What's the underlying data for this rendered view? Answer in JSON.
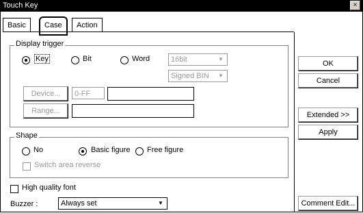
{
  "window": {
    "title": "Touch Key",
    "close_glyph": "×"
  },
  "tabs": [
    {
      "label": "Basic"
    },
    {
      "label": "Case"
    },
    {
      "label": "Action"
    }
  ],
  "display_trigger": {
    "group_label": "Display trigger",
    "options": [
      {
        "label": "Key",
        "selected": true
      },
      {
        "label": "Bit",
        "selected": false
      },
      {
        "label": "Word",
        "selected": false
      }
    ],
    "bit_select": {
      "value": "16bit",
      "arrow": "▼"
    },
    "format_select": {
      "value": "Signed BIN",
      "arrow": "▼"
    },
    "device_button": "Device...",
    "device_range_text": "0-FF",
    "range_button": "Range..."
  },
  "shape": {
    "group_label": "Shape",
    "options": [
      {
        "label": "No",
        "selected": false
      },
      {
        "label": "Basic figure",
        "selected": true
      },
      {
        "label": "Free figure",
        "selected": false
      }
    ],
    "switch_area_reverse": {
      "label": "Switch area reverse",
      "checked": false
    }
  },
  "high_quality_font": {
    "label": "High quality font",
    "checked": false
  },
  "buzzer": {
    "label": "Buzzer :",
    "value": "Always set",
    "arrow": "▼"
  },
  "side_buttons": {
    "ok": "OK",
    "cancel": "Cancel",
    "extended": "Extended >>",
    "apply": "Apply",
    "comment_edit": "Comment Edit..."
  }
}
